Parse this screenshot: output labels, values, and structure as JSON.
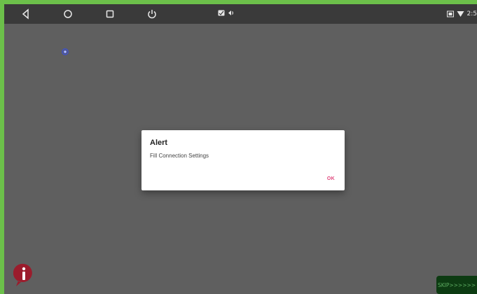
{
  "statusbar": {
    "time": "2:5",
    "icons": [
      "back-icon",
      "home-icon",
      "recents-icon",
      "power-icon",
      "notification-icon",
      "sync-icon",
      "cast-icon",
      "wifi-icon"
    ]
  },
  "dialog": {
    "title": "Alert",
    "message": "Fill Connection Settings",
    "ok_label": "OK"
  },
  "skip_button": {
    "label": "SKIP>>>>>>"
  },
  "colors": {
    "frame": "#6cc04a",
    "background": "#5f5f5f",
    "statusbar": "#3a3a3a",
    "accent": "#e0457b",
    "info_icon": "#9b1c2c",
    "skip_bg": "#0d3b12",
    "skip_text": "#5fae63"
  }
}
